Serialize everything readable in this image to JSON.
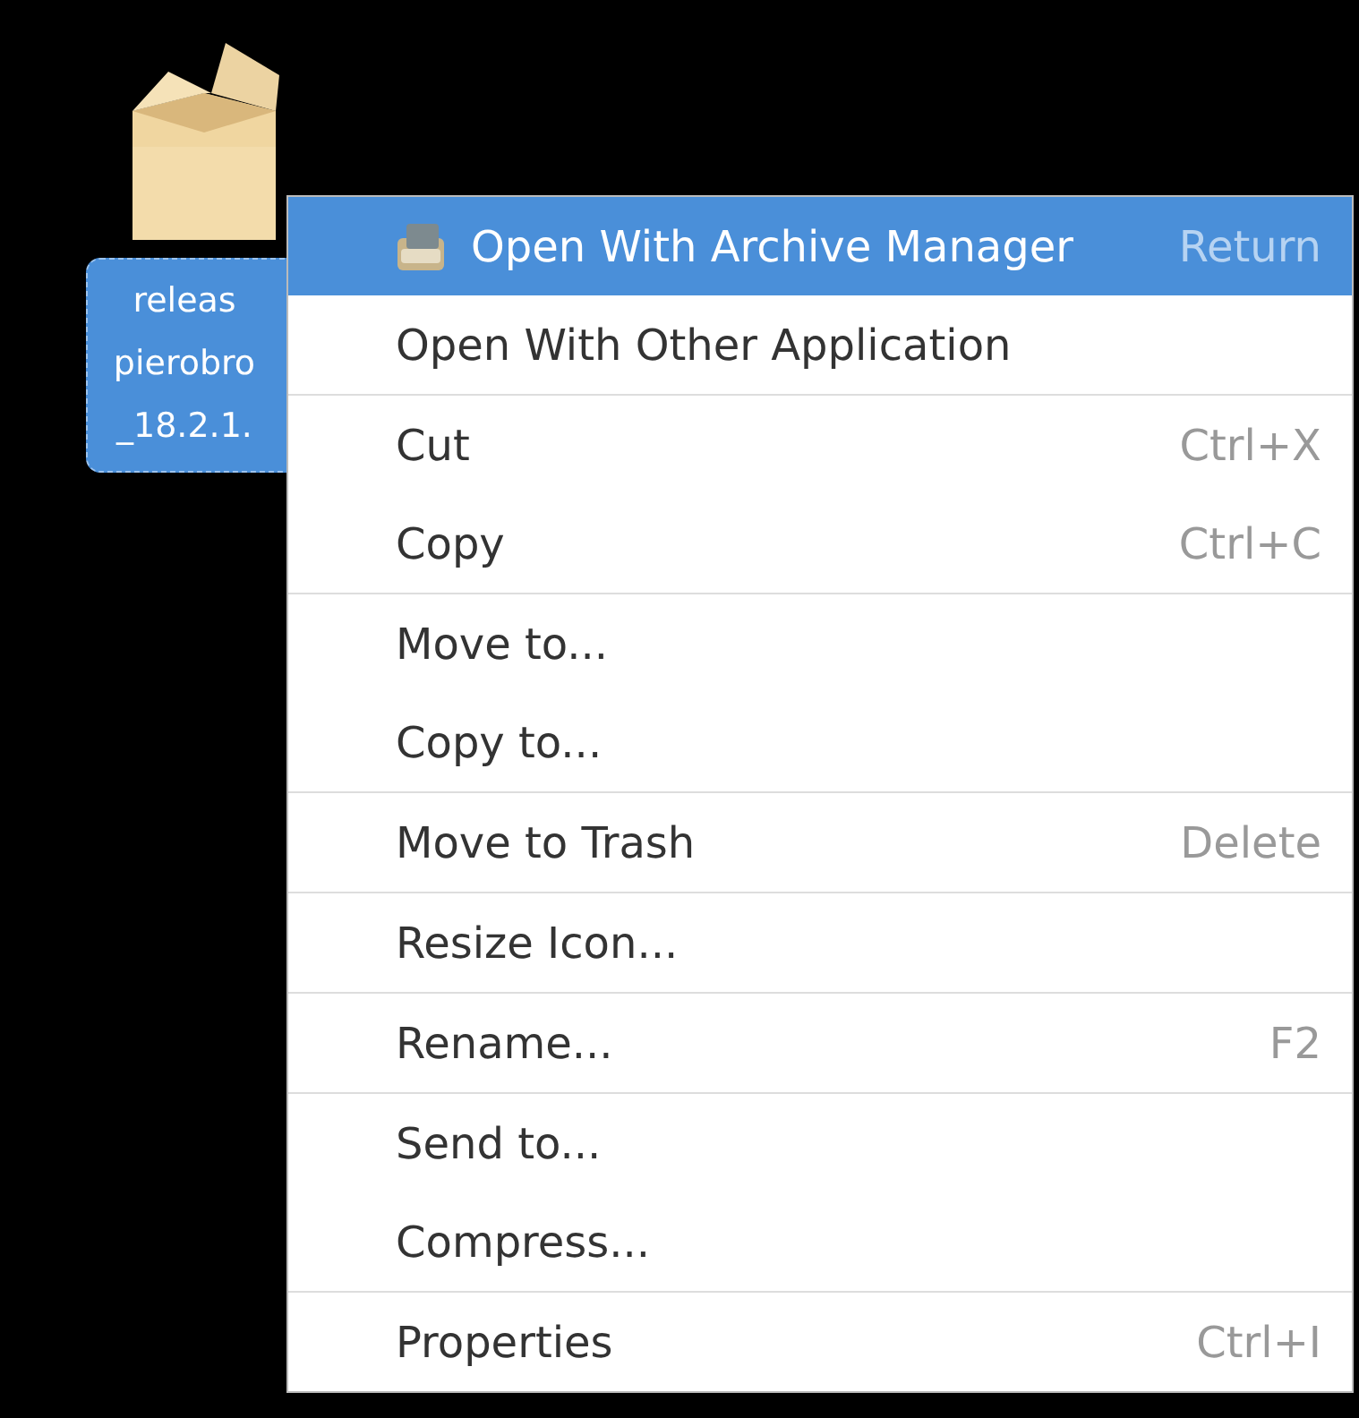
{
  "desktop_icon": {
    "label_lines": [
      "releas",
      "pierobro",
      "_18.2.1."
    ],
    "selected": true
  },
  "context_menu": {
    "sections": [
      {
        "items": [
          {
            "kind": "with-icon",
            "label": "Open With Archive Manager",
            "shortcut": "Return",
            "selected": true
          },
          {
            "kind": "plain",
            "label": "Open With Other Application",
            "selected": false
          }
        ]
      },
      {
        "items": [
          {
            "kind": "plain",
            "label": "Cut",
            "shortcut": "Ctrl+X",
            "selected": false
          },
          {
            "kind": "plain",
            "label": "Copy",
            "shortcut": "Ctrl+C",
            "selected": false
          }
        ]
      },
      {
        "items": [
          {
            "kind": "plain",
            "label": "Move to...",
            "selected": false
          },
          {
            "kind": "plain",
            "label": "Copy to...",
            "selected": false
          }
        ]
      },
      {
        "items": [
          {
            "kind": "plain",
            "label": "Move to Trash",
            "shortcut": "Delete",
            "selected": false
          }
        ]
      },
      {
        "items": [
          {
            "kind": "plain",
            "label": "Resize Icon...",
            "selected": false
          }
        ]
      },
      {
        "items": [
          {
            "kind": "plain",
            "label": "Rename...",
            "shortcut": "F2",
            "selected": false
          }
        ]
      },
      {
        "items": [
          {
            "kind": "plain",
            "label": "Send to...",
            "selected": false
          },
          {
            "kind": "plain",
            "label": "Compress...",
            "selected": false
          }
        ]
      },
      {
        "items": [
          {
            "kind": "plain",
            "label": "Properties",
            "shortcut": "Ctrl+I",
            "selected": false
          }
        ]
      }
    ]
  }
}
